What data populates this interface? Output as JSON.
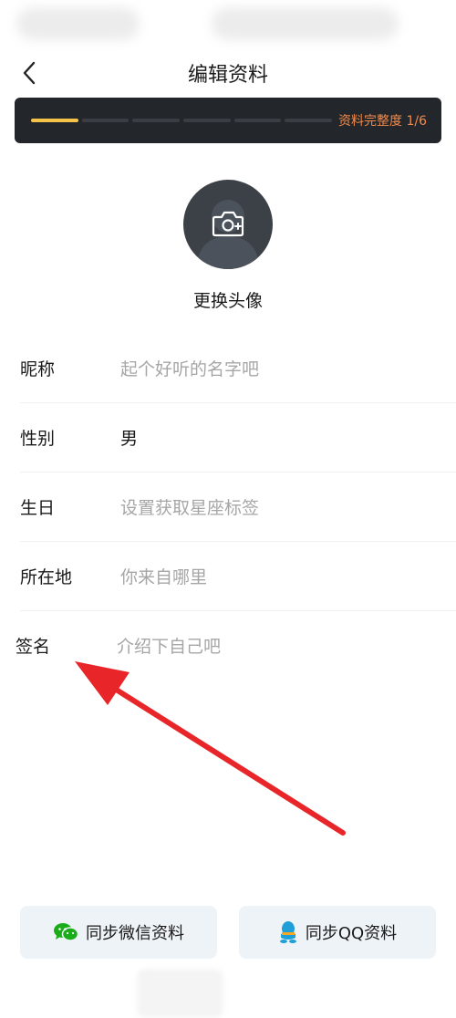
{
  "header": {
    "title": "编辑资料"
  },
  "profile_progress": {
    "label": "资料完整度 1/6",
    "completed_steps": 1,
    "total_steps": 6,
    "fill_color": "#f5c24a",
    "text_color": "#f08a4a"
  },
  "avatar": {
    "change_label": "更换头像"
  },
  "form": {
    "rows": [
      {
        "label": "昵称",
        "value": "起个好听的名字吧",
        "is_placeholder": true
      },
      {
        "label": "性别",
        "value": "男",
        "is_placeholder": false
      },
      {
        "label": "生日",
        "value": "设置获取星座标签",
        "is_placeholder": true
      },
      {
        "label": "所在地",
        "value": "你来自哪里",
        "is_placeholder": true
      },
      {
        "label": "签名",
        "value": "介绍下自己吧",
        "is_placeholder": true
      }
    ]
  },
  "sync": {
    "wechat_label": "同步微信资料",
    "qq_label": "同步QQ资料"
  },
  "icons": {
    "back": "chevron-left-icon",
    "camera": "camera-plus-icon",
    "wechat": "wechat-icon",
    "qq": "qq-icon"
  },
  "colors": {
    "accent_arrow": "#e8262a",
    "wechat_green": "#1aad19",
    "qq_blue": "#1e9fd8"
  }
}
